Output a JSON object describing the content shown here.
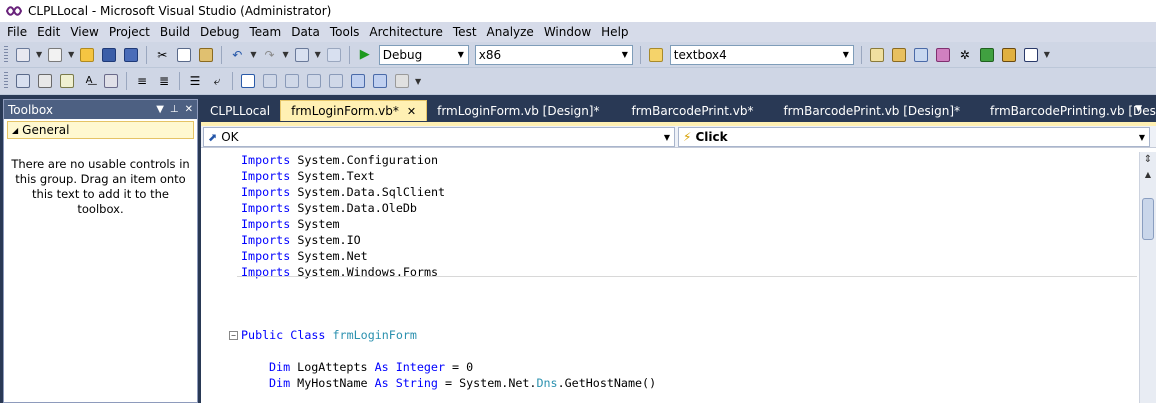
{
  "window": {
    "title": "CLPLLocal - Microsoft Visual Studio (Administrator)"
  },
  "menu": [
    "File",
    "Edit",
    "View",
    "Project",
    "Build",
    "Debug",
    "Team",
    "Data",
    "Tools",
    "Architecture",
    "Test",
    "Analyze",
    "Window",
    "Help"
  ],
  "toolbar": {
    "configuration": "Debug",
    "platform": "x86",
    "find_value": "textbox4"
  },
  "toolbox": {
    "title": "Toolbox",
    "group": "General",
    "empty_message": "There are no usable controls in this group. Drag an item onto this text to add it to the toolbox."
  },
  "tabs": [
    {
      "label": "CLPLLocal",
      "active": false
    },
    {
      "label": "frmLoginForm.vb*",
      "active": true
    },
    {
      "label": "frmLoginForm.vb [Design]*",
      "active": false
    },
    {
      "label": "frmBarcodePrint.vb*",
      "active": false
    },
    {
      "label": "frmBarcodePrint.vb [Design]*",
      "active": false
    },
    {
      "label": "frmBarcodePrinting.vb [Design]*",
      "active": false
    }
  ],
  "editor": {
    "object_combo": "OK",
    "event_combo": "Click",
    "code": {
      "imports_keyword": "Imports",
      "imports": [
        "System.Configuration",
        "System.Text",
        "System.Data.SqlClient",
        "System.Data.OleDb",
        "System",
        "System.IO",
        "System.Net",
        "System.Windows.Forms"
      ],
      "class_kw1": "Public",
      "class_kw2": "Class",
      "class_name": "frmLoginForm",
      "dim_kw": "Dim",
      "as_kw": "As",
      "var1_name": "LogAttepts",
      "var1_type": "Integer",
      "var1_init": " = 0",
      "var2_name": "MyHostName",
      "var2_type": "String",
      "var2_init_pre": " = System.Net.",
      "var2_init_type": "Dns",
      "var2_init_post": ".GetHostName()"
    }
  },
  "colors": {
    "background": "#293955",
    "keyword": "#0000ff",
    "type": "#2b91af",
    "active_tab": "#fff0b3",
    "toolbox_header": "#4d6082"
  }
}
